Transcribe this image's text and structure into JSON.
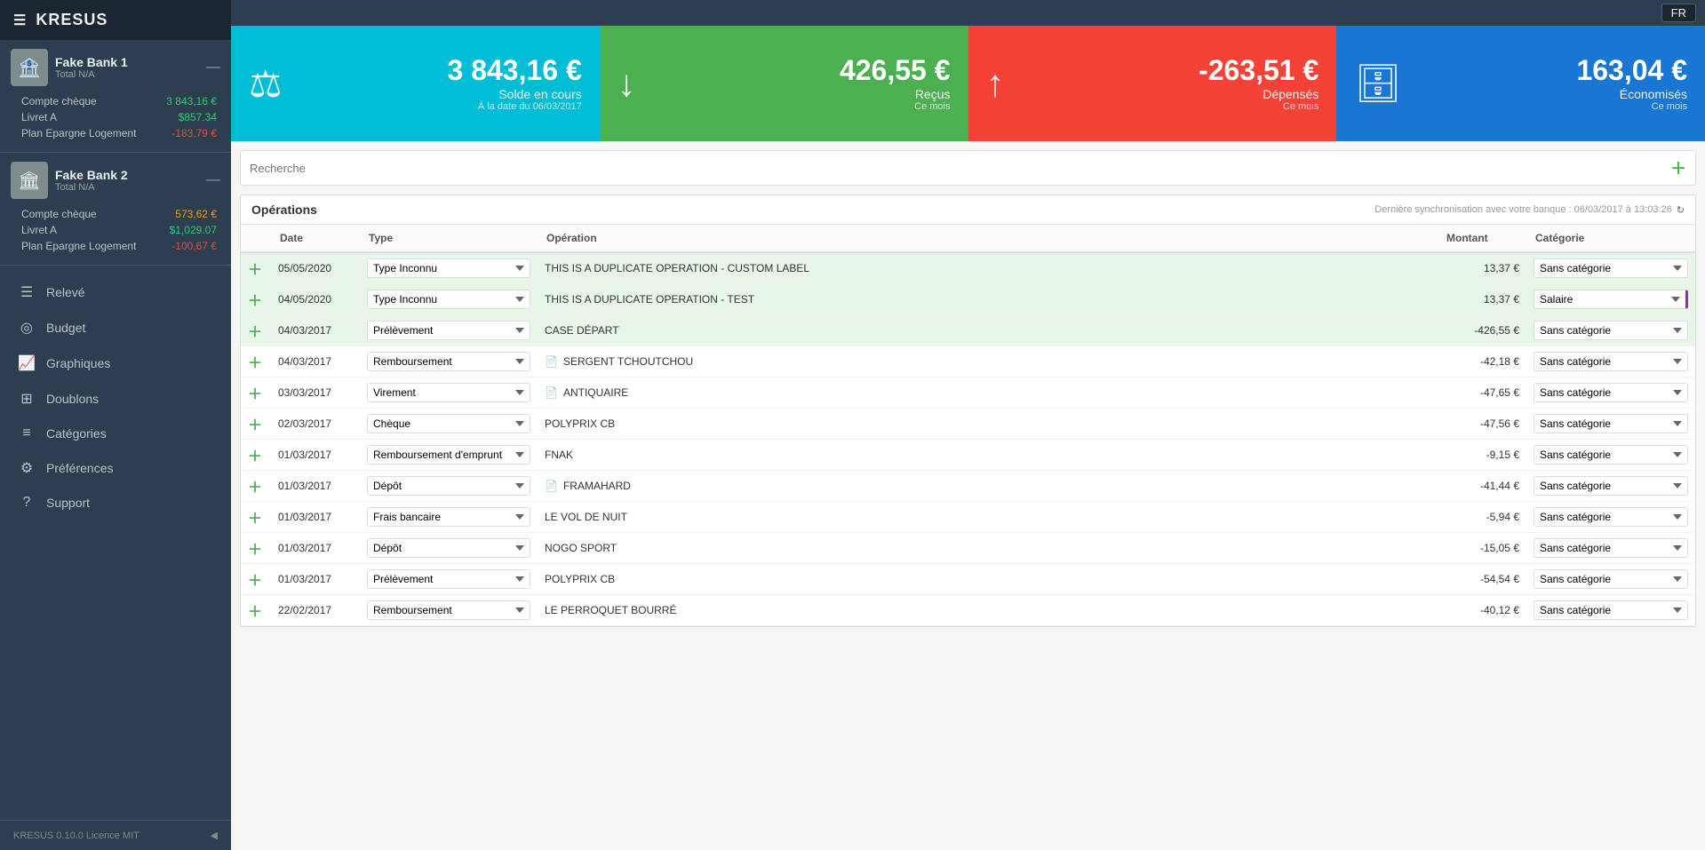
{
  "app": {
    "title": "KRESUS",
    "version": "KRESUS 0.10.0 Licence MIT",
    "language": "FR"
  },
  "sidebar": {
    "banks": [
      {
        "id": "bank1",
        "name": "Fake Bank 1",
        "total": "Total  N/A",
        "icon": "🏦",
        "accounts": [
          {
            "name": "Compte chèque",
            "value": "3 843,16 €",
            "type": "pos"
          },
          {
            "name": "Livret A",
            "value": "$857.34",
            "type": "pos"
          },
          {
            "name": "Plan Epargne Logement",
            "value": "-183,79 €",
            "type": "neg"
          }
        ]
      },
      {
        "id": "bank2",
        "name": "Fake Bank 2",
        "total": "Total  N/A",
        "icon": "🏛",
        "accounts": [
          {
            "name": "Compte chèque",
            "value": "573,62 €",
            "type": "warn"
          },
          {
            "name": "Livret A",
            "value": "$1,029.07",
            "type": "pos"
          },
          {
            "name": "Plan Epargne Logement",
            "value": "-100,67 €",
            "type": "neg"
          }
        ]
      }
    ],
    "nav": [
      {
        "id": "releve",
        "label": "Relevé",
        "icon": "☰"
      },
      {
        "id": "budget",
        "label": "Budget",
        "icon": "◎"
      },
      {
        "id": "graphiques",
        "label": "Graphiques",
        "icon": "📈"
      },
      {
        "id": "doublons",
        "label": "Doublons",
        "icon": "⊞"
      },
      {
        "id": "categories",
        "label": "Catégories",
        "icon": "≡"
      },
      {
        "id": "preferences",
        "label": "Préférences",
        "icon": "⚙"
      },
      {
        "id": "support",
        "label": "Support",
        "icon": "?"
      }
    ]
  },
  "cards": [
    {
      "id": "solde",
      "bg": "cyan",
      "icon": "⚖",
      "amount": "3 843,16 €",
      "label": "Solde en cours",
      "sublabel": "À la date du 06/03/2017"
    },
    {
      "id": "recus",
      "bg": "green",
      "icon": "↓",
      "amount": "426,55 €",
      "label": "Reçus",
      "sublabel": "Ce mois"
    },
    {
      "id": "depenses",
      "bg": "red",
      "icon": "↑",
      "amount": "-263,51 €",
      "label": "Dépensés",
      "sublabel": "Ce mois"
    },
    {
      "id": "economies",
      "bg": "blue",
      "icon": "🗄",
      "amount": "163,04 €",
      "label": "Économisés",
      "sublabel": "Ce mois"
    }
  ],
  "search": {
    "placeholder": "Recherche"
  },
  "operations": {
    "title": "Opérations",
    "sync_info": "Dernière synchronisation avec votre banque : 06/03/2017 à 13:03:26",
    "columns": [
      "",
      "Date",
      "Type",
      "Opération",
      "Montant",
      "Catégorie"
    ],
    "rows": [
      {
        "date": "05/05/2020",
        "type": "Type Inconnu",
        "operation": "THIS IS A DUPLICATE OPERATION - CUSTOM LABEL",
        "has_note": false,
        "amount": "13,37 €",
        "category": "Sans catégorie",
        "row_class": "dup1"
      },
      {
        "date": "04/05/2020",
        "type": "Type Inconnu",
        "operation": "THIS IS A DUPLICATE OPERATION - TEST",
        "has_note": false,
        "amount": "13,37 €",
        "category": "Salaire",
        "row_class": "dup2",
        "cat_special": true
      },
      {
        "date": "04/03/2017",
        "type": "Prélèvement",
        "operation": "CASE DÉPART",
        "has_note": false,
        "amount": "-426,55 €",
        "category": "Sans catégorie",
        "row_class": "case"
      },
      {
        "date": "04/03/2017",
        "type": "Remboursement",
        "operation": "SERGENT TCHOUTCHOU",
        "has_note": true,
        "amount": "-42,18 €",
        "category": "Sans catégorie",
        "row_class": ""
      },
      {
        "date": "03/03/2017",
        "type": "Virement",
        "operation": "ANTIQUAIRE",
        "has_note": true,
        "amount": "-47,65 €",
        "category": "Sans catégorie",
        "row_class": ""
      },
      {
        "date": "02/03/2017",
        "type": "Chèque",
        "operation": "POLYPRIX CB",
        "has_note": false,
        "amount": "-47,56 €",
        "category": "Sans catégorie",
        "row_class": ""
      },
      {
        "date": "01/03/2017",
        "type": "Remboursement d'emprunt",
        "operation": "FNAK",
        "has_note": false,
        "amount": "-9,15 €",
        "category": "Sans catégorie",
        "row_class": ""
      },
      {
        "date": "01/03/2017",
        "type": "Dépôt",
        "operation": "FRAMAHARD",
        "has_note": true,
        "amount": "-41,44 €",
        "category": "Sans catégorie",
        "row_class": ""
      },
      {
        "date": "01/03/2017",
        "type": "Frais bancaire",
        "operation": "LE VOL DE NUIT",
        "has_note": false,
        "amount": "-5,94 €",
        "category": "Sans catégorie",
        "row_class": ""
      },
      {
        "date": "01/03/2017",
        "type": "Dépôt",
        "operation": "NOGO SPORT",
        "has_note": false,
        "amount": "-15,05 €",
        "category": "Sans catégorie",
        "row_class": ""
      },
      {
        "date": "01/03/2017",
        "type": "Prélèvement",
        "operation": "POLYPRIX CB",
        "has_note": false,
        "amount": "-54,54 €",
        "category": "Sans catégorie",
        "row_class": ""
      },
      {
        "date": "22/02/2017",
        "type": "Remboursement",
        "operation": "LE PERROQUET BOURRÉ",
        "has_note": false,
        "amount": "-40,12 €",
        "category": "Sans catégorie",
        "row_class": ""
      }
    ]
  }
}
